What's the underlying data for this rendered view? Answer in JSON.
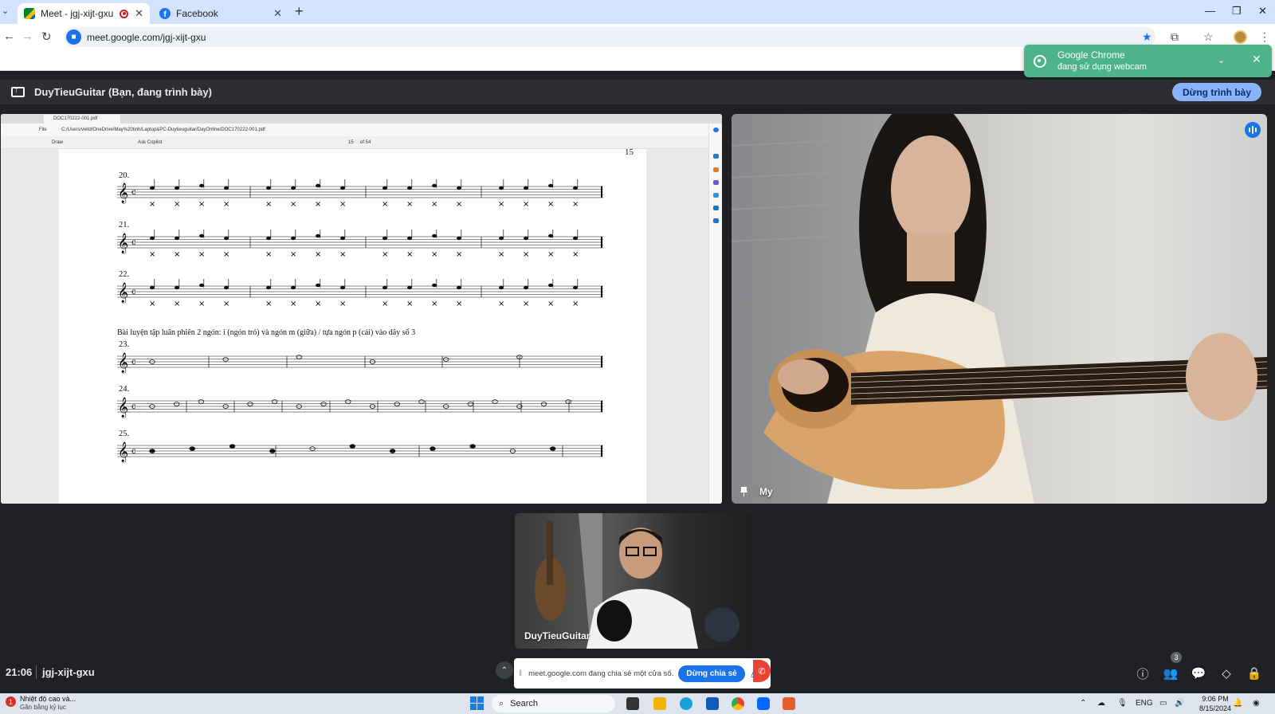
{
  "browser": {
    "tabs": [
      {
        "title": "Meet - jgj-xijt-gxu",
        "favicon": "meet-icon",
        "recording": true
      },
      {
        "title": "Facebook",
        "favicon": "facebook-icon",
        "recording": false
      }
    ],
    "url": "meet.google.com/jgj-xijt-gxu",
    "toast": {
      "title": "Google Chrome",
      "message": "đang sử dụng webcam"
    }
  },
  "meet": {
    "presentation_title": "DuyTieuGuitar (Bạn, đang trình bày)",
    "stop_presenting_label": "Dừng trình bày",
    "participants": [
      {
        "name": "My"
      },
      {
        "name": "DuyTieuGuitar"
      }
    ],
    "clock": "21:06",
    "meeting_code": "jgj-xijt-gxu",
    "participant_count": "3",
    "share_banner": {
      "message": "meet.google.com đang chia sẻ một cửa sổ.",
      "stop_label": "Dừng chia sẻ",
      "hide_label": "Ẩn"
    }
  },
  "shared_screen": {
    "pdf_tab_title": "DOC170222-001.pdf",
    "pdf_path": "C:/Users/vietd/OneDrive/May%20tinh/Laptop&PC-Duytieuguitar/DayOnline/DOC170222-001.pdf",
    "file_label": "File",
    "draw_label": "Draw",
    "ask_copilot_label": "Ask Copilot",
    "page_input": "15",
    "page_total": "of 54",
    "page_number": "15",
    "exercises": [
      "20.",
      "21.",
      "22.",
      "23.",
      "24.",
      "25."
    ],
    "caption": "Bài luyện tập luân phiên 2 ngón: i (ngón trỏ) và ngón m (giữa) / tựa ngón p (cái) vào dây số 3"
  },
  "taskbar": {
    "weather_title": "Nhiệt độ cao và...",
    "weather_sub": "Gần bằng kỷ lục",
    "weather_badge": "1",
    "search_placeholder": "Search",
    "lang": "ENG",
    "time": "9:06 PM",
    "date": "8/15/2024"
  },
  "colors": {
    "meet_background": "#202124",
    "accent_blue": "#8ab4f8",
    "end_call_red": "#ea4335",
    "toast_green": "#4db38a"
  }
}
